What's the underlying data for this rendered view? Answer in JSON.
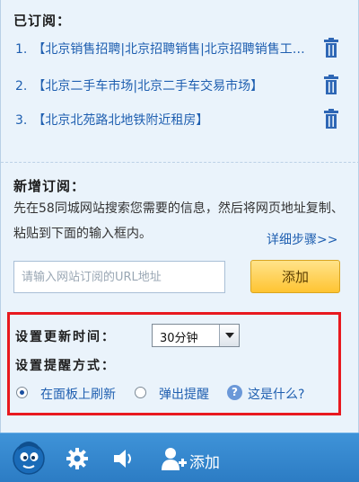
{
  "subscribed": {
    "title": "已订阅：",
    "items": [
      {
        "num": "1.",
        "label": "【北京销售招聘|北京招聘销售|北京招聘销售工作】"
      },
      {
        "num": "2.",
        "label": "【北京二手车市场|北京二手车交易市场】"
      },
      {
        "num": "3.",
        "label": "【北京北苑路北地铁附近租房】"
      }
    ],
    "delete_icon": "trash-icon"
  },
  "new_sub": {
    "title": "新增订阅：",
    "description": "先在58同城网站搜索您需要的信息，然后将网页地址复制、粘贴到下面的输入框内。",
    "detail_link": "详细步骤>>",
    "input_placeholder": "请输入网站订阅的URL地址",
    "input_value": "",
    "add_button": "添加"
  },
  "settings": {
    "update_time_label": "设置更新时间：",
    "update_time_value": "30分钟",
    "reminder_label": "设置提醒方式：",
    "option_panel_refresh": "在面板上刷新",
    "option_popup": "弹出提醒",
    "selected_option": "panel_refresh",
    "help_text": "这是什么?",
    "accent_color": "#e8191f"
  },
  "toolbar": {
    "add_label": "添加",
    "icons": [
      "mascot-icon",
      "gear-icon",
      "speaker-icon",
      "add-user-icon"
    ],
    "bg_color": "#2c7cc4"
  }
}
